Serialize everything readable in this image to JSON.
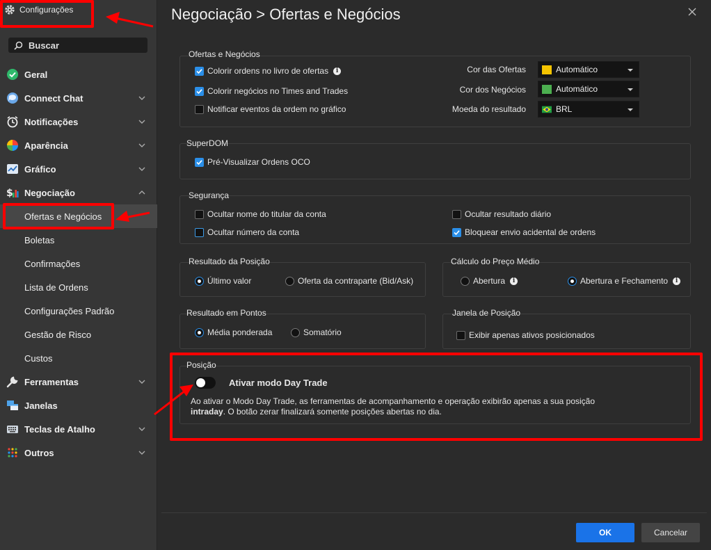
{
  "sidebar": {
    "title": "Configurações",
    "search_label": "Buscar",
    "items": [
      {
        "label": "Geral"
      },
      {
        "label": "Connect Chat"
      },
      {
        "label": "Notificações"
      },
      {
        "label": "Aparência"
      },
      {
        "label": "Gráfico"
      },
      {
        "label": "Negociação"
      },
      {
        "label": "Ferramentas"
      },
      {
        "label": "Janelas"
      },
      {
        "label": "Teclas de Atalho"
      },
      {
        "label": "Outros"
      }
    ],
    "sub_items": [
      {
        "label": "Ofertas e Negócios"
      },
      {
        "label": "Boletas"
      },
      {
        "label": "Confirmações"
      },
      {
        "label": "Lista de Ordens"
      },
      {
        "label": "Configurações Padrão"
      },
      {
        "label": "Gestão de Risco"
      },
      {
        "label": "Custos"
      }
    ]
  },
  "main": {
    "title": "Negociação > Ofertas e Negócios",
    "ofertas": {
      "label": "Ofertas e Negócios",
      "opt1": "Colorir ordens no livro de ofertas",
      "opt2": "Colorir negócios no Times and Trades",
      "opt3": "Notificar eventos da ordem no gráfico",
      "cor_ofertas_label": "Cor das Ofertas",
      "cor_ofertas_value": "Automático",
      "cor_ofertas_color": "#f5c400",
      "cor_negocios_label": "Cor dos Negócios",
      "cor_negocios_value": "Automático",
      "cor_negocios_color": "#4caf50",
      "moeda_label": "Moeda do resultado",
      "moeda_value": "BRL"
    },
    "superdom": {
      "label": "SuperDOM",
      "opt1": "Pré-Visualizar Ordens OCO"
    },
    "seguranca": {
      "label": "Segurança",
      "opt1": "Ocultar nome do titular da conta",
      "opt2": "Ocultar número da conta",
      "opt3": "Ocultar resultado diário",
      "opt4": "Bloquear envio acidental de ordens"
    },
    "resultado_posicao": {
      "label": "Resultado da Posição",
      "opt1": "Último valor",
      "opt2": "Oferta da contraparte (Bid/Ask)"
    },
    "calculo_preco": {
      "label": "Cálculo do Preço Médio",
      "opt1": "Abertura",
      "opt2": "Abertura e Fechamento"
    },
    "resultado_pontos": {
      "label": "Resultado em Pontos",
      "opt1": "Média ponderada",
      "opt2": "Somatório"
    },
    "janela_posicao": {
      "label": "Janela de Posição",
      "opt1": "Exibir apenas ativos posicionados"
    },
    "posicao": {
      "label": "Posição",
      "toggle_label": "Ativar modo Day Trade",
      "desc_line1": "Ao ativar o Modo Day Trade, as ferramentas de acompanhamento e operação exibirão apenas a sua posição",
      "desc_bold": "intraday",
      "desc_line2": ". O botão zerar finalizará somente posições abertas no dia."
    }
  },
  "footer": {
    "ok": "OK",
    "cancel": "Cancelar"
  }
}
